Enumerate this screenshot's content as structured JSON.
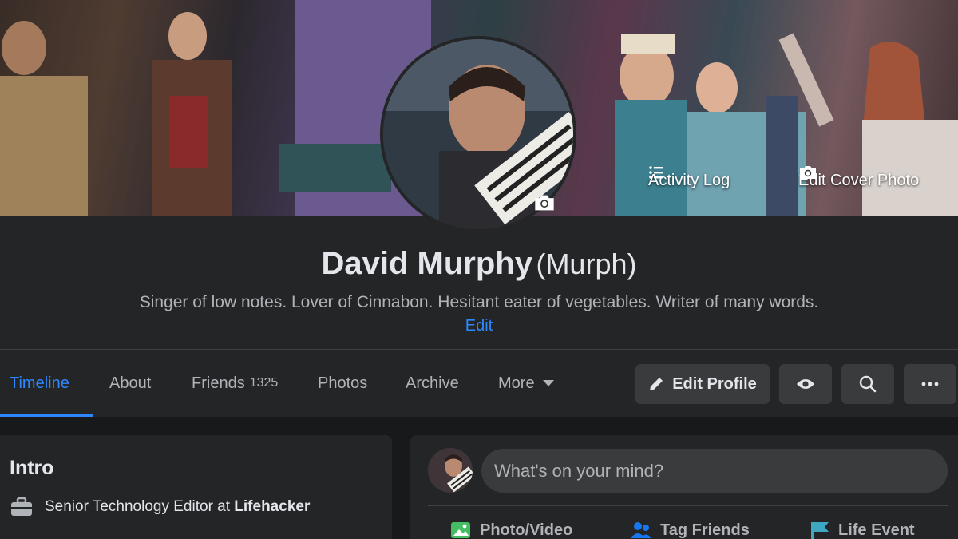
{
  "cover": {
    "activity_log_label": "Activity Log",
    "edit_cover_label": "Edit Cover Photo"
  },
  "profile": {
    "name": "David Murphy",
    "nickname": "(Murph)",
    "bio": "Singer of low notes. Lover of Cinnabon. Hesitant eater of vegetables. Writer of many words.",
    "edit_label": "Edit"
  },
  "tabs": [
    {
      "label": "Timeline",
      "active": true
    },
    {
      "label": "About"
    },
    {
      "label": "Friends",
      "count": "1325"
    },
    {
      "label": "Photos"
    },
    {
      "label": "Archive"
    },
    {
      "label": "More"
    }
  ],
  "actions": {
    "edit_profile_label": "Edit Profile"
  },
  "intro": {
    "title": "Intro",
    "work_role": "Senior Technology Editor at ",
    "work_place": "Lifehacker"
  },
  "composer": {
    "placeholder": "What's on your mind?",
    "actions": [
      {
        "label": "Photo/Video",
        "icon": "photo-icon",
        "color": "#45bd62"
      },
      {
        "label": "Tag Friends",
        "icon": "tag-friends-icon",
        "color": "#1877f2"
      },
      {
        "label": "Life Event",
        "icon": "flag-icon",
        "color": "#3ea8c2"
      }
    ]
  },
  "colors": {
    "accent": "#2d88ff",
    "background": "#18191a",
    "card": "#242526",
    "button": "#3a3b3c"
  }
}
